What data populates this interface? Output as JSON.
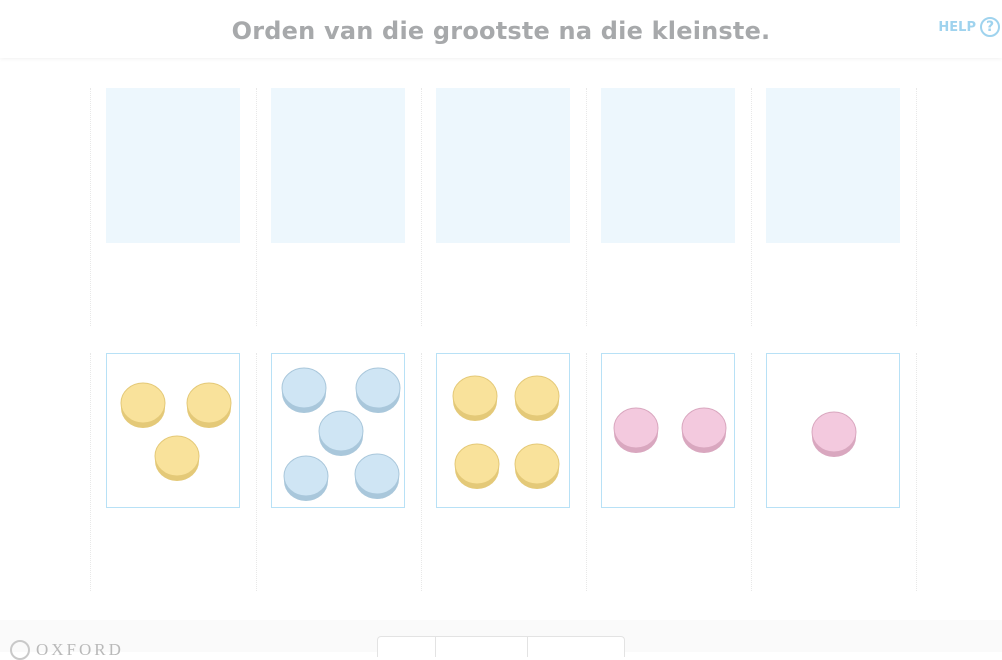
{
  "header": {
    "title": "Orden van die grootste na die kleinste.",
    "help_label": "HELP",
    "help_icon_glyph": "?"
  },
  "answer_slots": 5,
  "cards": [
    {
      "counters": 3,
      "color": "yellow"
    },
    {
      "counters": 5,
      "color": "blue"
    },
    {
      "counters": 4,
      "color": "yellow"
    },
    {
      "counters": 2,
      "color": "pink"
    },
    {
      "counters": 1,
      "color": "pink"
    }
  ],
  "colors": {
    "yellow_fill": "#f9e29b",
    "yellow_rim": "#e4c978",
    "blue_fill": "#cfe5f4",
    "blue_rim": "#a9c7db",
    "pink_fill": "#f3c9de",
    "pink_rim": "#d9a7bf",
    "slot_bg": "#edf7fd",
    "card_border": "#b8e1f6",
    "title": "#a7a9ab",
    "help": "#9fd3ee"
  },
  "footer": {
    "brand": "OXFORD"
  }
}
